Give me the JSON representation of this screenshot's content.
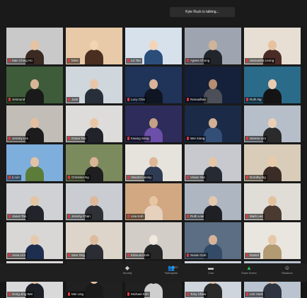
{
  "talking_indicator": "Kyle Ruck is talking...",
  "participants": [
    {
      "name": "Man Ching Ho",
      "colors": [
        "#c9c9c9",
        "#3a2a22",
        "#e5c3a3"
      ]
    },
    {
      "name": "Mimi",
      "colors": [
        "#e8c9a8",
        "#4a2e1f",
        "#f3d3b4"
      ]
    },
    {
      "name": "LK Tan",
      "colors": [
        "#d6e1ec",
        "#2b4d7a",
        "#f4d4b8"
      ]
    },
    {
      "name": "Agnes Chong",
      "colors": [
        "#9fa5b0",
        "#22252c",
        "#cfb49b"
      ]
    },
    {
      "name": "Samantha Leong",
      "colors": [
        "#e7dfd4",
        "#4b2b26",
        "#e7c2a0"
      ]
    },
    {
      "name": "Jesmund",
      "colors": [
        "#3e5c3a",
        "#1a1a1a",
        "#d8b596"
      ]
    },
    {
      "name": "Jack",
      "colors": [
        "#cfd6dc",
        "#272f3a",
        "#e8c7a9"
      ]
    },
    {
      "name": "Lucy Chin",
      "colors": [
        "#203358",
        "#0f1522",
        "#d9b59a"
      ]
    },
    {
      "name": "Ramadhan",
      "colors": [
        "#15203b",
        "#4c4f57",
        "#b58d73"
      ]
    },
    {
      "name": "Ruth Ng",
      "colors": [
        "#2a6b8a",
        "#141414",
        "#e9cbb0"
      ]
    },
    {
      "name": "Jeremy Lim",
      "colors": [
        "#c2bdb7",
        "#1c1c1c",
        "#e2bfa0"
      ]
    },
    {
      "name": "Grace Teo",
      "colors": [
        "#dedcda",
        "#20232a",
        "#e7c7a6"
      ]
    },
    {
      "name": "Kwang Seng",
      "colors": [
        "#2d2c5b",
        "#6b4fa8",
        "#c5a084"
      ]
    },
    {
      "name": "Wei Xiang",
      "colors": [
        "#1b2a47",
        "#334f78",
        "#d1b194"
      ]
    },
    {
      "name": "Serene Lim",
      "colors": [
        "#b6bfc9",
        "#2b2b2b",
        "#e9cfb6"
      ]
    },
    {
      "name": "Li Lin",
      "colors": [
        "#7eaedb",
        "#5c7c3a",
        "#e2c2a4"
      ]
    },
    {
      "name": "Christine Ng",
      "colors": [
        "#7c8b5d",
        "#1f1f1f",
        "#d9b395"
      ]
    },
    {
      "name": "Vincent Leong",
      "colors": [
        "#e6e2dc",
        "#2f3b52",
        "#dcb796"
      ]
    },
    {
      "name": "Vivian Yeo",
      "colors": [
        "#c7c9cf",
        "#252a33",
        "#e5c6a7"
      ]
    },
    {
      "name": "Dorothy Ng",
      "colors": [
        "#d9cdb9",
        "#3a2c26",
        "#e9cbaa"
      ]
    },
    {
      "name": "Jason Tan",
      "colors": [
        "#cfd1d4",
        "#21252b",
        "#e3c4a5"
      ]
    },
    {
      "name": "Jeremy Chan",
      "colors": [
        "#c9cdd2",
        "#2e3136",
        "#deb89a"
      ]
    },
    {
      "name": "Lisa Koh",
      "colors": [
        "#d1a882",
        "#e6d1bd",
        "#e6c5a3"
      ]
    },
    {
      "name": "Ruth Low",
      "colors": [
        "#aeb6c1",
        "#1f2024",
        "#e4c8ae"
      ]
    },
    {
      "name": "Mark Lee",
      "colors": [
        "#e0ddd7",
        "#4a3a32",
        "#e4c29f"
      ]
    },
    {
      "name": "Anna Lim",
      "colors": [
        "#d8d7d5",
        "#1d2e4f",
        "#e7caae"
      ]
    },
    {
      "name": "Sam Ong",
      "colors": [
        "#ddd5ca",
        "#2a2d33",
        "#ddbb9d"
      ]
    },
    {
      "name": "Edmund Koh",
      "colors": [
        "#d3cdc8",
        "#272727",
        "#f0e8de"
      ]
    },
    {
      "name": "Susan Goh",
      "colors": [
        "#5b6e83",
        "#334b66",
        "#d6b499"
      ]
    },
    {
      "name": "Daniel",
      "colors": [
        "#e9e5df",
        "#b29a73",
        "#e6c8a8"
      ]
    },
    {
      "name": "Hong Jing Wei",
      "colors": [
        "#d9d9d9",
        "#1c2026",
        "#e8c9aa"
      ]
    },
    {
      "name": "Mei Ling",
      "colors": [
        "#202020",
        "#1a1a1a",
        "#e0c1a1"
      ]
    },
    {
      "name": "Michael Koh",
      "colors": [
        "#202020",
        "#cfcfcf",
        "#202020"
      ]
    },
    {
      "name": "Tony Chew",
      "colors": [
        "#cfd5dd",
        "#2a2a2a",
        "#e5c7a7"
      ]
    },
    {
      "name": "Lim Hock",
      "colors": [
        "#b9c4d0",
        "#2f3540",
        "#deba9a"
      ]
    }
  ],
  "toolbar": [
    {
      "label": "Security",
      "icon": "shield-icon",
      "glyph": "◆"
    },
    {
      "label": "Participants",
      "icon": "participants-icon",
      "glyph": "👥",
      "count": "207"
    },
    {
      "label": "Chat",
      "icon": "chat-icon",
      "glyph": "▬"
    },
    {
      "label": "Share Screen",
      "icon": "share-screen-icon",
      "glyph": "▲",
      "accent": "#27c24c"
    },
    {
      "label": "Reactions",
      "icon": "reactions-icon",
      "glyph": "☺"
    }
  ]
}
